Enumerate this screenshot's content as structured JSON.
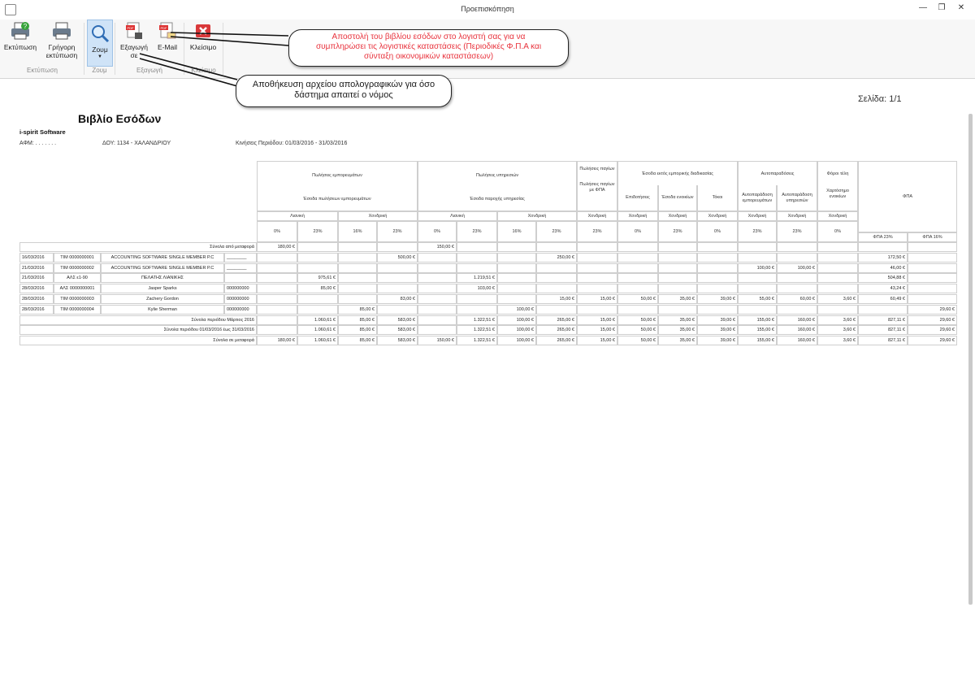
{
  "window": {
    "title": "Προεπισκόπηση",
    "minimize": "—",
    "restore": "❐",
    "close": "✕"
  },
  "ribbon": {
    "buttons": [
      {
        "id": "print",
        "label": "Εκτύπωση"
      },
      {
        "id": "quick_print",
        "label": "Γρήγορη εκτύπωση"
      },
      {
        "id": "zoom",
        "label": "Ζουμ"
      },
      {
        "id": "export",
        "label": "Εξαγωγή σε"
      },
      {
        "id": "email",
        "label": "E-Mail"
      },
      {
        "id": "close",
        "label": "Κλείσιμο"
      }
    ],
    "groups": [
      "Εκτύπωση",
      "Ζουμ",
      "Εξαγωγή",
      "Κλείσιμο"
    ]
  },
  "callouts": {
    "email_tip": "Αποστολή του βιβλίου εσόδων στο λογιστή σας για να συμπληρώσει τις λογιστικές καταστάσεις (Περιοδικές Φ.Π.Α και σύνταξη οικονομικών καταστάσεων)",
    "export_tip": "Αποθήκευση αρχείου απολογραφικών για όσο δάστημα απαιτεί ο νόμος"
  },
  "colors": {
    "email_tip_text": "#e8323c",
    "export_tip_text": "#1a1a1a"
  },
  "page": {
    "label": "Σελίδα: 1/1"
  },
  "report": {
    "title": "Βιβλίο Εσόδων",
    "company": "i-spirit Software",
    "afm": "ΑΦΜ: . . . . . . . ",
    "doy": "ΔΟΥ: 1134 - ΧΑΛΑΝΔΡΙΟΥ",
    "period": "Κινήσεις Περιόδου: 01/03/2016 - 31/03/2016"
  },
  "header": {
    "g1": "Πωλήσεις εμπορευμάτων",
    "g1s": "Έσοδα πωλήσεων εμπορευμάτων",
    "g2": "Πωλήσεις υπηρεσιών",
    "g2s": "Έσοδα παροχής υπηρεσίας",
    "g3": "Πωλήσεις παγίων",
    "g3s": "Πωλήσεις παγίων με ΦΠΑ",
    "g4": "Έσοδα εκτός εμπορικής διαδικασίας",
    "g4a": "Επιδοτήσεις",
    "g4b": "Έσοδα ενοικίων",
    "g4c": "Τόκοι",
    "g5": "Αυτοπαραδόσεις",
    "g5a": "Αυτοπαράδοση εμπορευμάτων",
    "g5b": "Αυτοπαράδοση υπηρεσιών",
    "g6": "Φόροι τέλη",
    "g6s": "Χαρτόσημο ενοικίων",
    "g7": "ΦΠΑ",
    "retail": "Λιανική",
    "wholesale": "Χονδρική",
    "p0": "0%",
    "p23": "23%",
    "p16": "16%",
    "vat23": "ΦΠΑ 23%",
    "vat16": "ΦΠΑ 16%"
  },
  "rows": [
    {
      "date": "",
      "doc": "",
      "name": "Σύνολα από μεταφορά",
      "code": "",
      "v": [
        "180,00 €",
        "",
        "",
        "",
        "150,00 €",
        "",
        "",
        "",
        "",
        "",
        "",
        "",
        "",
        "",
        "",
        "",
        "",
        ""
      ],
      "span_label": true
    },
    {
      "date": "16/03/2016",
      "doc": "ΤΙΜ 0000000001",
      "name": "ACCOUNTING SOFTWARE SINGLE MEMBER P.C",
      "code": "________",
      "v": [
        "",
        "",
        "",
        "500,00 €",
        "",
        "",
        "",
        "250,00 €",
        "",
        "",
        "",
        "",
        "",
        "",
        "",
        "",
        "172,50 €",
        ""
      ]
    },
    {
      "date": "21/03/2016",
      "doc": "ΤΙΜ 0000000002",
      "name": "ACCOUNTING SOFTWARE SINGLE MEMBER P.C",
      "code": "________",
      "v": [
        "",
        "",
        "",
        "",
        "",
        "",
        "",
        "",
        "",
        "",
        "",
        "",
        "100,00 €",
        "100,00 €",
        "",
        "",
        "46,00 €",
        ""
      ]
    },
    {
      "date": "21/03/2016",
      "doc": "ΑΛΣ ε1-90",
      "name": "ΠΕΛΑΤΗΣ ΛΙΑΝΙΚΗΣ",
      "code": "",
      "v": [
        "",
        "975,61 €",
        "",
        "",
        "",
        "1.219,51 €",
        "",
        "",
        "",
        "",
        "",
        "",
        "",
        "",
        "",
        "",
        "504,88 €",
        ""
      ]
    },
    {
      "date": "28/03/2016",
      "doc": "ΑΛΣ 0000000001",
      "name": "Jasper Sparks",
      "code": "000000000",
      "v": [
        "",
        "85,00 €",
        "",
        "",
        "",
        "103,00 €",
        "",
        "",
        "",
        "",
        "",
        "",
        "",
        "",
        "",
        "",
        "43,24 €",
        ""
      ]
    },
    {
      "date": "28/03/2016",
      "doc": "ΤΙΜ 0000000003",
      "name": "Zachery Gordon",
      "code": "000000000",
      "v": [
        "",
        "",
        "",
        "83,00 €",
        "",
        "",
        "",
        "15,00 €",
        "15,00 €",
        "50,00 €",
        "35,00 €",
        "39,00 €",
        "55,00 €",
        "60,00 €",
        "3,60 €",
        "",
        "60,49 €",
        ""
      ]
    },
    {
      "date": "28/03/2016",
      "doc": "ΤΙΜ 0000000004",
      "name": "Kylie Sherman",
      "code": "000000000",
      "v": [
        "",
        "",
        "85,00 €",
        "",
        "",
        "",
        "100,00 €",
        "",
        "",
        "",
        "",
        "",
        "",
        "",
        "",
        "",
        "",
        "29,60 €"
      ]
    },
    {
      "date": "",
      "doc": "",
      "name": "Σύνολα περιόδου Μάρτιος 2016",
      "code": "",
      "v": [
        "",
        "1.060,61 €",
        "85,00 €",
        "583,00 €",
        "",
        "1.322,51 €",
        "100,00 €",
        "265,00 €",
        "15,00 €",
        "50,00 €",
        "35,00 €",
        "39,00 €",
        "155,00 €",
        "160,00 €",
        "3,60 €",
        "",
        "827,11 €",
        "29,60 €"
      ],
      "span_label": true
    },
    {
      "date": "",
      "doc": "",
      "name": "Σύνολα περιόδου 01/03/2016 έως 31/03/2016",
      "code": "",
      "v": [
        "",
        "1.060,61 €",
        "85,00 €",
        "583,00 €",
        "",
        "1.322,51 €",
        "100,00 €",
        "265,00 €",
        "15,00 €",
        "50,00 €",
        "35,00 €",
        "39,00 €",
        "155,00 €",
        "160,00 €",
        "3,60 €",
        "",
        "827,11 €",
        "29,60 €"
      ],
      "span_label": true
    },
    {
      "date": "",
      "doc": "",
      "name": "Σύνολα σε μεταφορά",
      "code": "",
      "v": [
        "180,00 €",
        "1.060,61 €",
        "85,00 €",
        "583,00 €",
        "150,00 €",
        "1.322,51 €",
        "100,00 €",
        "265,00 €",
        "15,00 €",
        "50,00 €",
        "35,00 €",
        "39,00 €",
        "155,00 €",
        "160,00 €",
        "3,60 €",
        "",
        "827,11 €",
        "29,60 €"
      ],
      "span_label": true
    }
  ]
}
